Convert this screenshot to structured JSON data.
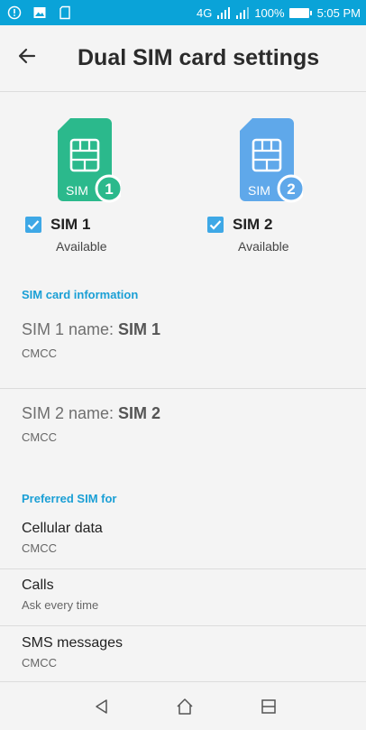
{
  "status_bar": {
    "network": "4G",
    "battery": "100%",
    "time": "5:05 PM"
  },
  "header": {
    "title": "Dual SIM card settings"
  },
  "sims": [
    {
      "label": "SIM 1",
      "status": "Available",
      "badge": "1",
      "card_text": "SIM",
      "checked": true,
      "color": "#2bb98c"
    },
    {
      "label": "SIM 2",
      "status": "Available",
      "badge": "2",
      "card_text": "SIM",
      "checked": true,
      "color": "#5fa8ea"
    }
  ],
  "sim_info": {
    "section_title": "SIM card information",
    "sim1": {
      "prefix": "SIM 1 name: ",
      "name": "SIM 1",
      "carrier": "CMCC"
    },
    "sim2": {
      "prefix": "SIM 2 name: ",
      "name": "SIM 2",
      "carrier": "CMCC"
    }
  },
  "preferred": {
    "section_title": "Preferred SIM for",
    "items": [
      {
        "title": "Cellular data",
        "value": "CMCC"
      },
      {
        "title": "Calls",
        "value": "Ask every time"
      },
      {
        "title": "SMS messages",
        "value": "CMCC"
      }
    ]
  },
  "colors": {
    "status_bar": "#0aa3d8",
    "accent": "#1a9fd5",
    "checkbox": "#3ea8e6"
  }
}
